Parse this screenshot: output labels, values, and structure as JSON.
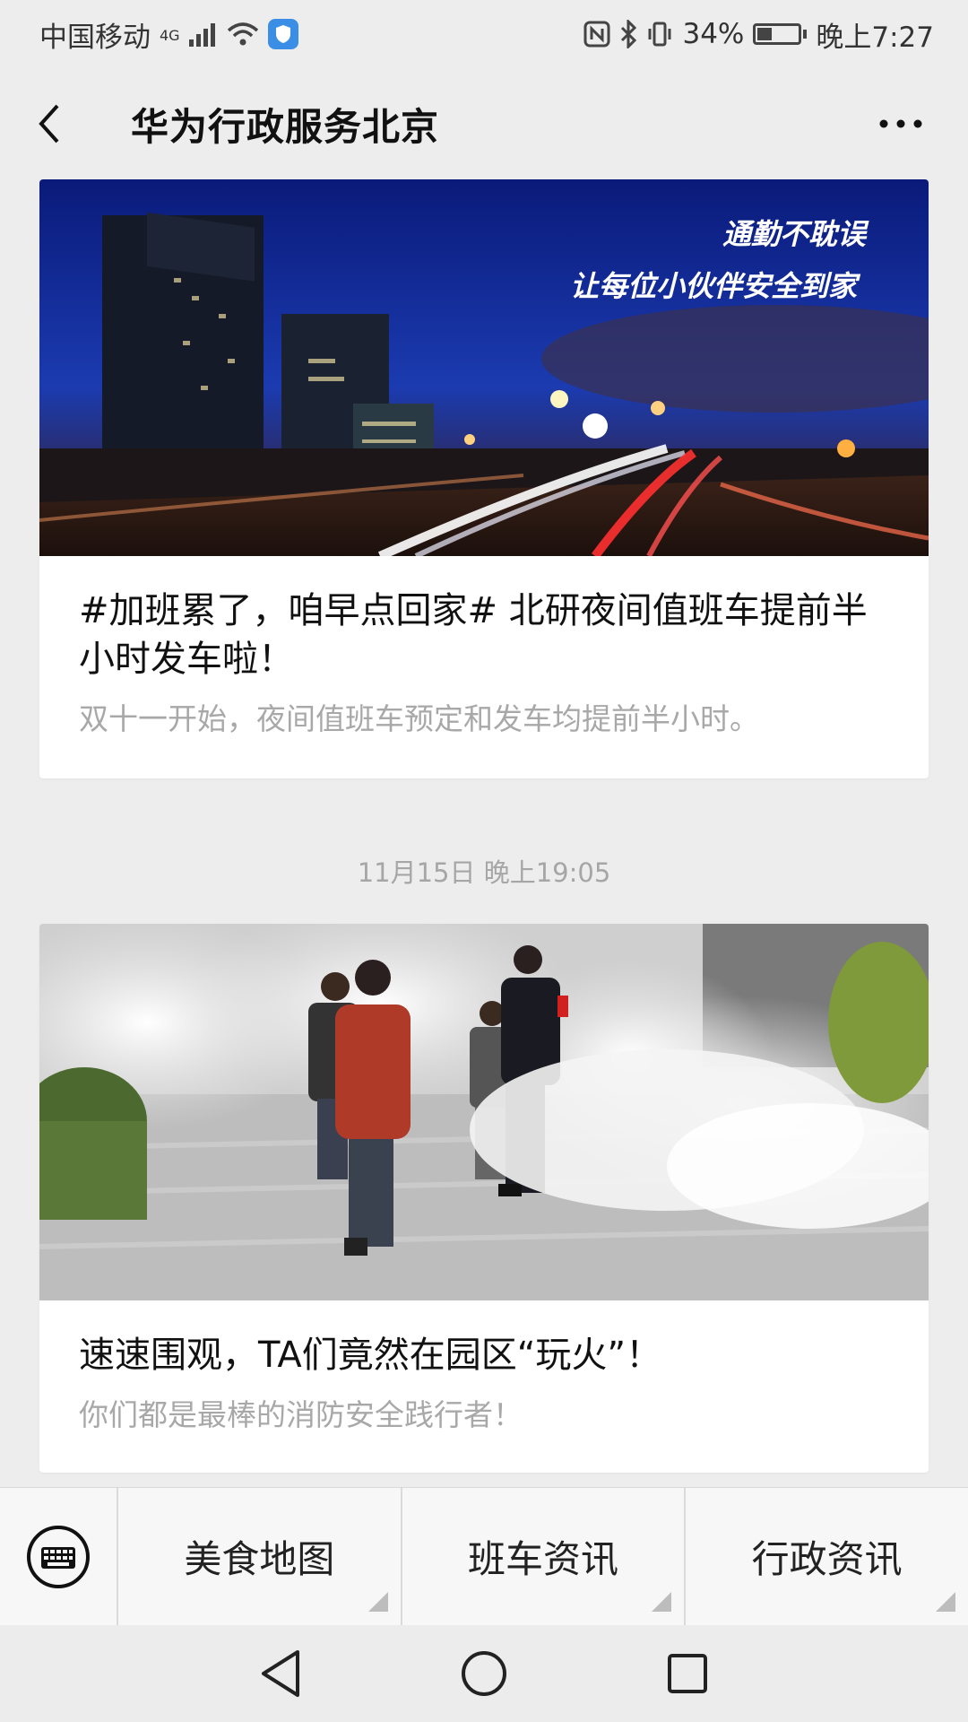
{
  "status_bar": {
    "carrier": "中国移动",
    "network": "4G",
    "battery": "34%",
    "time": "晚上7:27"
  },
  "header": {
    "title": "华为行政服务北京"
  },
  "articles": [
    {
      "cover_line1": "通勤不耽误",
      "cover_line2": "让每位小伙伴安全到家",
      "title": "#加班累了，咱早点回家# 北研夜间值班车提前半小时发车啦！",
      "desc": "双十一开始，夜间值班车预定和发车均提前半小时。"
    },
    {
      "title": "速速围观，TA们竟然在园区“玩火”！",
      "desc": "你们都是最棒的消防安全践行者！"
    }
  ],
  "timestamp": "11月15日 晚上19:05",
  "menu": {
    "items": [
      "美食地图",
      "班车资讯",
      "行政资讯"
    ]
  },
  "colors": {
    "background": "#ededed",
    "card": "#ffffff",
    "muted_text": "#a8a8a8"
  }
}
